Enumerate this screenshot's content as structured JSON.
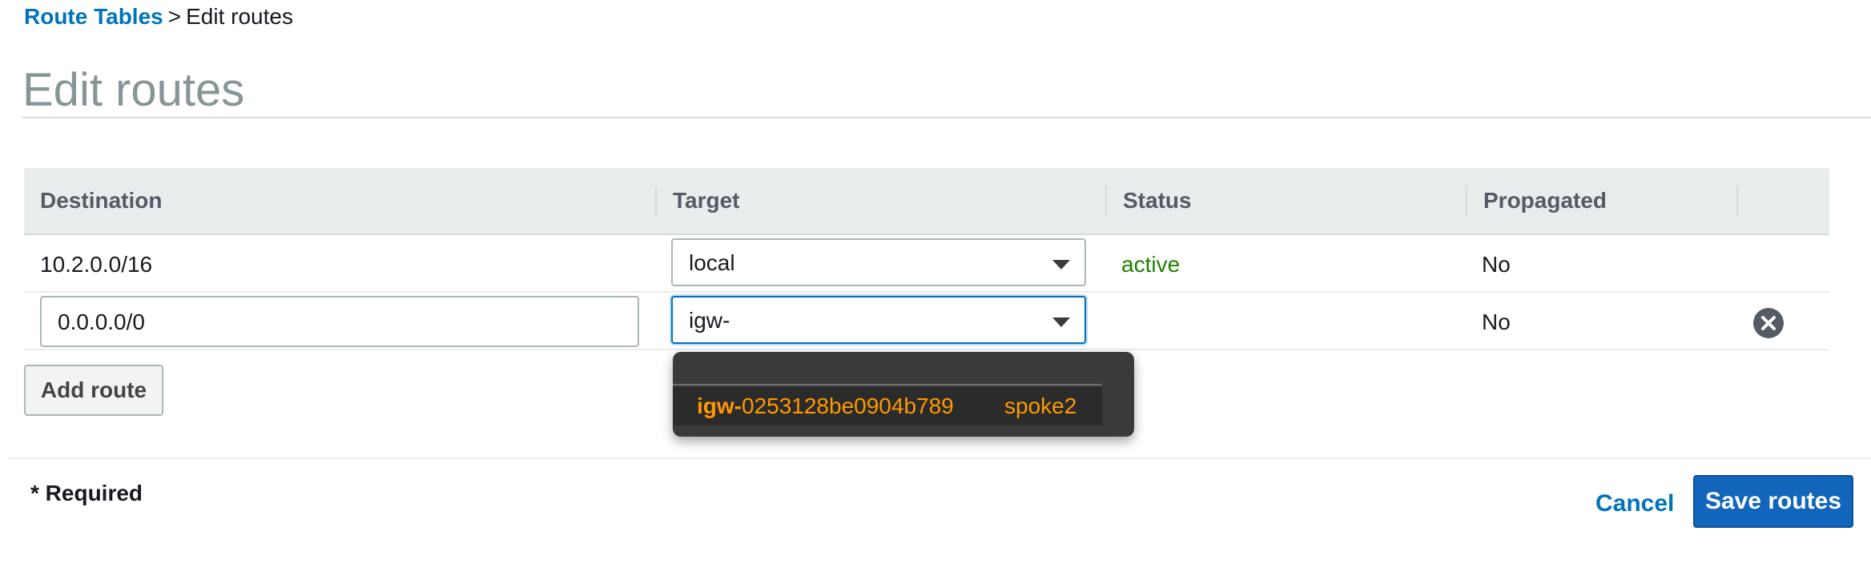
{
  "breadcrumb": {
    "parent": "Route Tables",
    "separator": ">",
    "current": "Edit routes"
  },
  "page": {
    "title": "Edit routes"
  },
  "table": {
    "columns": [
      "Destination",
      "Target",
      "Status",
      "Propagated"
    ],
    "rows": [
      {
        "destination": "10.2.0.0/16",
        "target": "local",
        "status": "active",
        "propagated": "No",
        "editable": false
      },
      {
        "destination": "0.0.0.0/0",
        "target": "igw-",
        "status": "",
        "propagated": "No",
        "editable": true
      }
    ]
  },
  "dropdown": {
    "options": [
      {
        "id_prefix": "igw-",
        "id_rest": "0253128be0904b789",
        "name": "spoke2"
      }
    ]
  },
  "buttons": {
    "add_route": "Add route",
    "cancel": "Cancel",
    "save": "Save routes"
  },
  "footer": {
    "required_note": "* Required"
  },
  "colors": {
    "link": "#0073bb",
    "status_active": "#1d8102",
    "primary_button": "#1166bb",
    "dropdown_highlight": "#ff9900",
    "dropdown_bg": "#3a3a3a"
  },
  "icons": {
    "caret": "caret-down-icon",
    "remove": "remove-circle-icon"
  }
}
